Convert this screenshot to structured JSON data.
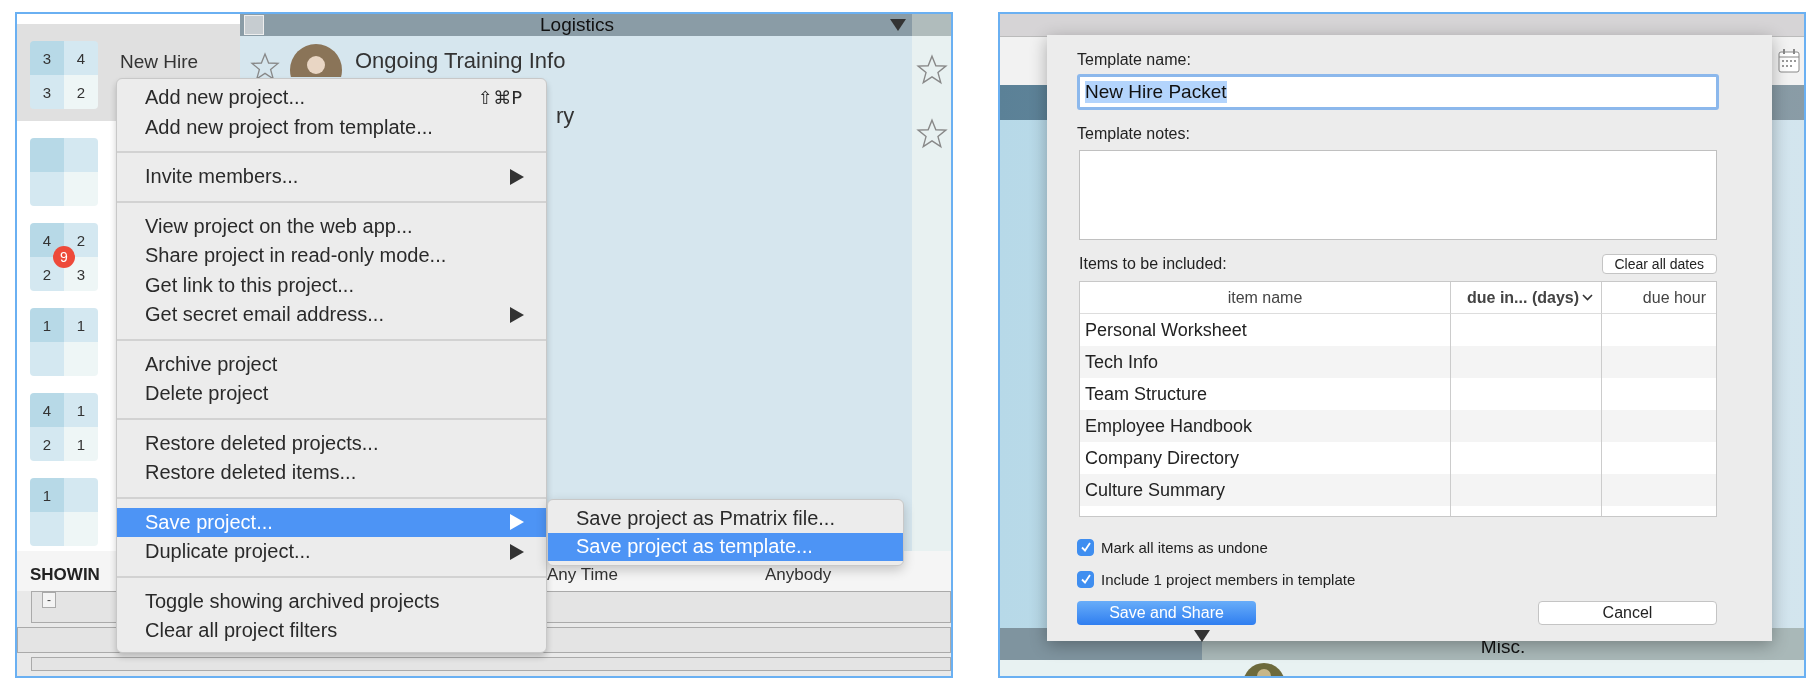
{
  "left_window": {
    "header": {
      "title": "Logistics",
      "checked": false
    },
    "projects": [
      {
        "name": "New Hire",
        "selected": true,
        "counts": [
          "3",
          "4",
          "3",
          "2"
        ]
      },
      {
        "selected": false
      },
      {
        "selected": false,
        "counts": [
          "4",
          "2",
          "2",
          "3"
        ],
        "badge": "9"
      },
      {
        "selected": false,
        "counts": [
          "1",
          "1"
        ]
      },
      {
        "selected": false,
        "counts": [
          "4",
          "1",
          "2",
          "1"
        ]
      },
      {
        "selected": false,
        "counts": [
          "1"
        ]
      }
    ],
    "items": [
      {
        "kind": "full",
        "title": "Ongoing Training Info",
        "starred": false
      },
      {
        "kind": "partial",
        "title": "ry",
        "starred": false
      }
    ],
    "filter_bar": {
      "label": "SHOWIN",
      "time": "Any Time",
      "people": "Anybody"
    },
    "stack_button": "-",
    "context_menu": {
      "groups": [
        [
          {
            "label": "Add new project...",
            "shortcut": "⇧⌘P",
            "submenu": false,
            "selected": false
          },
          {
            "label": "Add new project from template...",
            "submenu": false,
            "selected": false
          }
        ],
        [
          {
            "label": "Invite members...",
            "submenu": true,
            "selected": false
          }
        ],
        [
          {
            "label": "View project on the web app...",
            "submenu": false,
            "selected": false
          },
          {
            "label": "Share project in read-only mode...",
            "submenu": false,
            "selected": false
          },
          {
            "label": "Get link to this project...",
            "submenu": false,
            "selected": false
          },
          {
            "label": "Get secret email address...",
            "submenu": true,
            "selected": false
          }
        ],
        [
          {
            "label": "Archive project",
            "submenu": false,
            "selected": false
          },
          {
            "label": "Delete project",
            "submenu": false,
            "selected": false
          }
        ],
        [
          {
            "label": "Restore deleted projects...",
            "submenu": false,
            "selected": false
          },
          {
            "label": "Restore deleted items...",
            "submenu": false,
            "selected": false
          }
        ],
        [
          {
            "label": "Save project...",
            "submenu": true,
            "selected": true
          },
          {
            "label": "Duplicate project...",
            "submenu": true,
            "selected": false
          }
        ],
        [
          {
            "label": "Toggle showing archived projects",
            "submenu": false,
            "selected": false
          },
          {
            "label": "Clear all project filters",
            "submenu": false,
            "selected": false
          }
        ]
      ]
    },
    "submenu": {
      "items": [
        {
          "label": "Save project as Pmatrix file...",
          "selected": false
        },
        {
          "label": "Save project as template...",
          "selected": true
        }
      ]
    }
  },
  "right_window": {
    "dialog": {
      "name_label": "Template name:",
      "name_field": {
        "value": "New Hire Packet",
        "text_selected": true
      },
      "notes_label": "Template notes:",
      "items_label": "Items to be included:",
      "clear_button": "Clear all dates",
      "table": {
        "columns": [
          "item name",
          "due in... (days)",
          "due hour"
        ],
        "rows": [
          "Personal Worksheet",
          "Tech Info",
          "Team Structure",
          "Employee Handbook",
          "Company Directory",
          "Culture Summary"
        ]
      },
      "options": [
        {
          "label": "Mark all items as undone",
          "checked": true
        },
        {
          "label": "Include 1 project members in template",
          "checked": true
        }
      ],
      "primary_button": "Save and Share",
      "cancel_button": "Cancel"
    },
    "bottom_section": {
      "title": "Misc."
    }
  }
}
